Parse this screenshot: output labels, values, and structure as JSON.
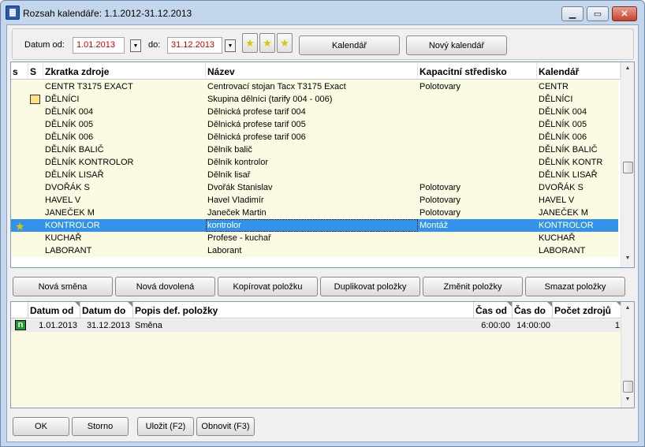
{
  "window": {
    "title": "Rozsah kalendáře: 1.1.2012-31.12.2013",
    "min": "▁",
    "max": "▭",
    "close": "✕"
  },
  "filter": {
    "date_from_label": "Datum od:",
    "date_from": "1.01.2013",
    "date_to_label": "do:",
    "date_to": "31.12.2013",
    "calendar_button": "Kalendář",
    "new_calendar_button": "Nový kalendář",
    "dropdown_glyph": "▼"
  },
  "resources": {
    "headers": {
      "s1": "s",
      "s2": "S",
      "code": "Zkratka zdroje",
      "name": "Název",
      "center": "Kapacitní středisko",
      "calendar": "Kalendář"
    },
    "rows": [
      {
        "code": "CENTR T3175 EXACT",
        "name": "Centrovací stojan Tacx T3175 Exact",
        "center": "Polotovary",
        "calendar": "CENTR",
        "icon": ""
      },
      {
        "code": "DĚLNÍCI",
        "name": "Skupina dělníci (tarify 004 - 006)",
        "center": "",
        "calendar": "DĚLNÍCI",
        "icon": "group-icon"
      },
      {
        "code": "DĚLNÍK 004",
        "name": "Dělnická profese tarif 004",
        "center": "",
        "calendar": "DĚLNÍK 004",
        "icon": ""
      },
      {
        "code": "DĚLNÍK 005",
        "name": "Dělnická profese tarif 005",
        "center": "",
        "calendar": "DĚLNÍK 005",
        "icon": ""
      },
      {
        "code": "DĚLNÍK 006",
        "name": "Dělnická profese tarif 006",
        "center": "",
        "calendar": "DĚLNÍK 006",
        "icon": ""
      },
      {
        "code": "DĚLNÍK BALIČ",
        "name": "Dělník balič",
        "center": "",
        "calendar": "DĚLNÍK BALIČ",
        "icon": ""
      },
      {
        "code": "DĚLNÍK KONTROLOR",
        "name": "Dělník kontrolor",
        "center": "",
        "calendar": "DĚLNÍK KONTR",
        "icon": ""
      },
      {
        "code": "DĚLNÍK LISAŘ",
        "name": "Dělník lisař",
        "center": "",
        "calendar": "DĚLNÍK LISAŘ",
        "icon": ""
      },
      {
        "code": "DVOŘÁK S",
        "name": "Dvořák Stanislav",
        "center": "Polotovary",
        "calendar": "DVOŘÁK S",
        "icon": ""
      },
      {
        "code": "HAVEL V",
        "name": "Havel Vladimír",
        "center": "Polotovary",
        "calendar": "HAVEL V",
        "icon": ""
      },
      {
        "code": "JANEČEK M",
        "name": "Janeček Martin",
        "center": "Polotovary",
        "calendar": "JANEČEK M",
        "icon": ""
      },
      {
        "code": "KONTROLOR",
        "name": "kontrolor",
        "center": "Montáž",
        "calendar": "KONTROLOR",
        "icon": "star-icon",
        "selected": true
      },
      {
        "code": "KUCHAŘ",
        "name": "Profese - kuchař",
        "center": "",
        "calendar": "KUCHAŘ",
        "icon": ""
      },
      {
        "code": "LABORANT",
        "name": "Laborant",
        "center": "",
        "calendar": "LABORANT",
        "icon": ""
      }
    ]
  },
  "actions": {
    "new_shift": "Nová směna",
    "new_vacation": "Nová dovolená",
    "copy_item": "Kopírovat položku",
    "duplicate_items": "Duplikovat položky",
    "change_items": "Změnit položky",
    "delete_items": "Smazat položky"
  },
  "definitions": {
    "headers": {
      "date_from": "Datum od",
      "date_to": "Datum do",
      "desc": "Popis def. položky",
      "time_from": "Čas od",
      "time_to": "Čas do",
      "count": "Počet zdrojů"
    },
    "rows": [
      {
        "date_from": "1.01.2013",
        "date_to": "31.12.2013",
        "desc": "Směna",
        "time_from": "6:00:00",
        "time_to": "14:00:00",
        "count": "1",
        "icon": "n"
      }
    ]
  },
  "footer": {
    "ok": "OK",
    "cancel": "Storno",
    "save": "Uložit (F2)",
    "refresh": "Obnovit (F3)"
  }
}
